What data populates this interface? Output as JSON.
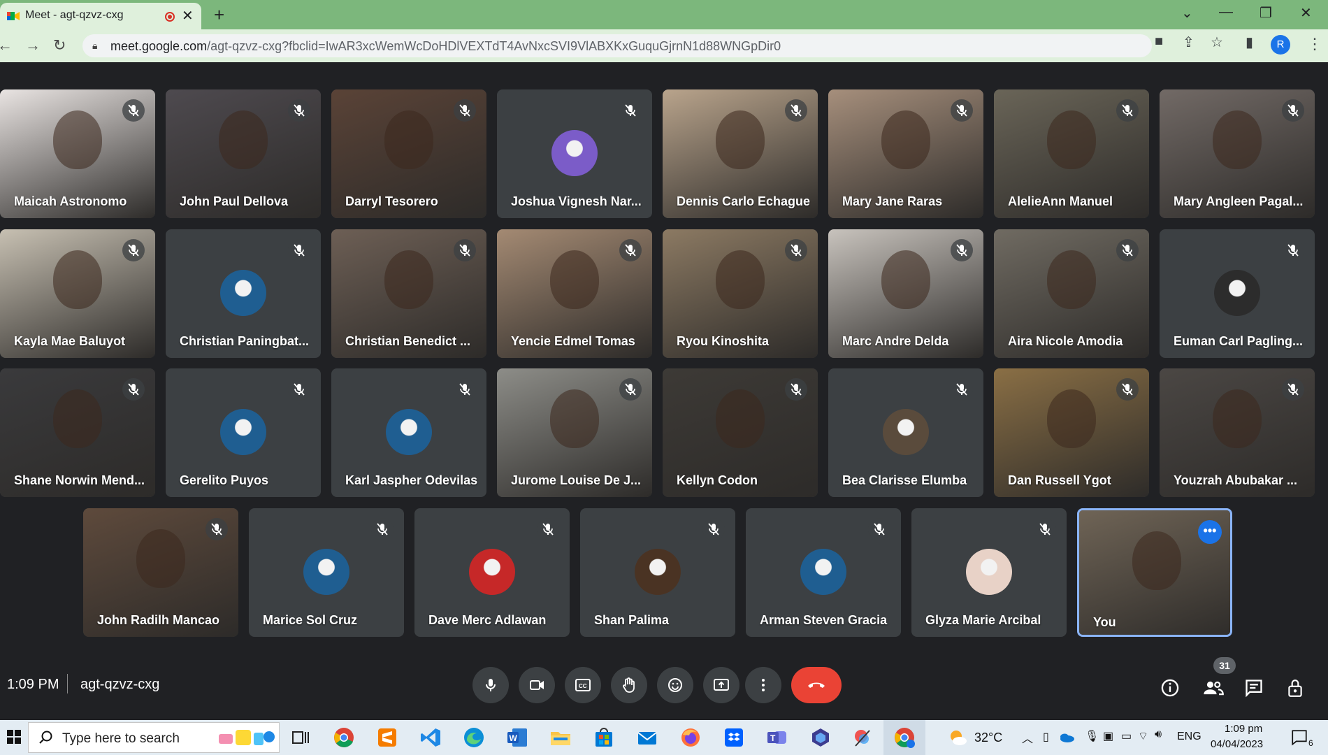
{
  "browser": {
    "tab_title": "Meet - agt-qzvz-cxg",
    "new_tab_label": "+",
    "url_host": "meet.google.com",
    "url_path": "/agt-qzvz-cxg?fbclid=IwAR3xcWemWcDoHDlVEXTdT4AvNxcSVI9VlABXKxGuquGjrnN1d88WNGpDir0",
    "profile_initial": "R"
  },
  "participants": [
    {
      "name": "Maicah Astronomo",
      "type": "video",
      "bg": "#e9e4e2"
    },
    {
      "name": "John Paul Dellova",
      "type": "video",
      "bg": "#4e4a4f"
    },
    {
      "name": "Darryl Tesorero",
      "type": "video",
      "bg": "#5a4337"
    },
    {
      "name": "Joshua Vignesh Nar...",
      "type": "avatar",
      "avatar_color": "#7b5cc8"
    },
    {
      "name": "Dennis Carlo Echague",
      "type": "video",
      "bg": "#b9a48c"
    },
    {
      "name": "Mary Jane Raras",
      "type": "video",
      "bg": "#a68f7c"
    },
    {
      "name": "AlelieAnn Manuel",
      "type": "video",
      "bg": "#6a6558"
    },
    {
      "name": "Mary Angleen Pagal...",
      "type": "video",
      "bg": "#726a66"
    },
    {
      "name": "Kayla Mae Baluyot",
      "type": "video",
      "bg": "#c7c0b2"
    },
    {
      "name": "Christian Paningbat...",
      "type": "avatar",
      "avatar_color": "#1f5e91"
    },
    {
      "name": "Christian Benedict ...",
      "type": "video",
      "bg": "#6d5f55"
    },
    {
      "name": "Yencie Edmel Tomas",
      "type": "video",
      "bg": "#a48a73"
    },
    {
      "name": "Ryou Kinoshita",
      "type": "video",
      "bg": "#8c7a63"
    },
    {
      "name": "Marc Andre Delda",
      "type": "video",
      "bg": "#c8c3bd"
    },
    {
      "name": "Aira Nicole Amodia",
      "type": "video",
      "bg": "#706b62"
    },
    {
      "name": "Euman Carl Pagling...",
      "type": "avatar",
      "avatar_color": "#2c2c2c"
    },
    {
      "name": "Shane Norwin Mend...",
      "type": "video",
      "bg": "#3a3a3c"
    },
    {
      "name": "Gerelito Puyos",
      "type": "avatar",
      "avatar_color": "#1f5e91"
    },
    {
      "name": "Karl Jaspher Odevilas",
      "type": "avatar",
      "avatar_color": "#1f5e91"
    },
    {
      "name": "Jurome Louise De J...",
      "type": "video",
      "bg": "#8d8d88"
    },
    {
      "name": "Kellyn Codon",
      "type": "video",
      "bg": "#3d3a36"
    },
    {
      "name": "Bea Clarisse Elumba",
      "type": "avatar",
      "avatar_color": "#5a4b3c"
    },
    {
      "name": "Dan Russell Ygot",
      "type": "video",
      "bg": "#8a6f45"
    },
    {
      "name": "Youzrah Abubakar ...",
      "type": "video",
      "bg": "#4b4744"
    },
    {
      "name": "John Radilh Mancao",
      "type": "video",
      "bg": "#5e4a3c"
    },
    {
      "name": "Marice Sol Cruz",
      "type": "avatar",
      "avatar_color": "#1f5e91"
    },
    {
      "name": "Dave Merc Adlawan",
      "type": "avatar",
      "avatar_color": "#c62828"
    },
    {
      "name": "Shan Palima",
      "type": "avatar",
      "avatar_color": "#4a3323"
    },
    {
      "name": "Arman Steven Gracia",
      "type": "avatar",
      "avatar_color": "#1f5e91"
    },
    {
      "name": "Glyza Marie Arcibal",
      "type": "avatar",
      "avatar_color": "#e8d2c7"
    },
    {
      "name": "You",
      "type": "self",
      "bg": "#6f6456"
    }
  ],
  "meeting": {
    "time": "1:09 PM",
    "code": "agt-qzvz-cxg",
    "participant_count": "31"
  },
  "taskbar": {
    "search_placeholder": "Type here to search",
    "weather": "32°C",
    "language": "ENG",
    "clock_time": "1:09 pm",
    "clock_date": "04/04/2023",
    "notification_count": "6"
  },
  "colors": {
    "end_call": "#ea4335",
    "self_border": "#8ab4f8",
    "meet_bg": "#202124",
    "tile_bg": "#3c4043"
  }
}
